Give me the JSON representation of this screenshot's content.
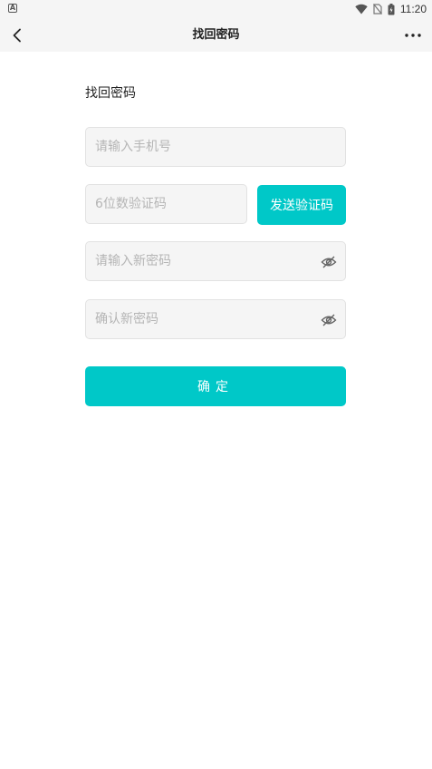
{
  "status_bar": {
    "left_badge": "A",
    "time": "11:20",
    "icons": [
      "wifi-icon",
      "no-sim-icon",
      "battery-icon"
    ]
  },
  "nav": {
    "title": "找回密码",
    "back_icon": "chevron-left-icon",
    "more_icon": "more-horizontal-icon"
  },
  "form": {
    "heading": "找回密码",
    "phone_placeholder": "请输入手机号",
    "code_placeholder": "6位数验证码",
    "send_code_label": "发送验证码",
    "new_password_placeholder": "请输入新密码",
    "confirm_password_placeholder": "确认新密码",
    "toggle_icon": "eye-off-icon",
    "submit_label": "确定"
  },
  "colors": {
    "accent": "#00c8c8",
    "field_bg": "#f5f5f5",
    "bar_bg": "#f5f5f5"
  }
}
